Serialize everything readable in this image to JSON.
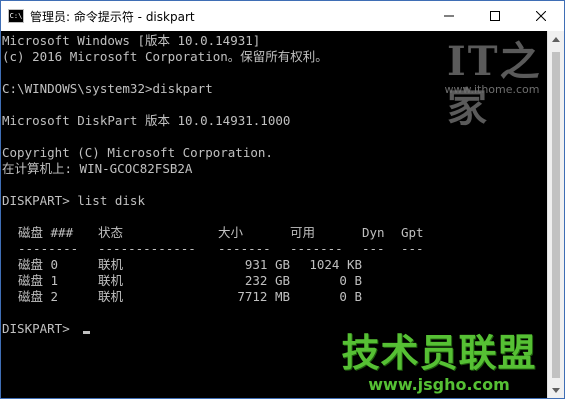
{
  "window": {
    "icon_text": "C:\\",
    "title": "管理员: 命令提示符 - diskpart",
    "controls": {
      "minimize": "minimize",
      "maximize": "maximize",
      "close": "close"
    }
  },
  "console": {
    "lines": [
      "Microsoft Windows [版本 10.0.14931]",
      "(c) 2016 Microsoft Corporation。保留所有权利。",
      "",
      "C:\\WINDOWS\\system32>diskpart",
      "",
      "Microsoft DiskPart 版本 10.0.14931.1000",
      "",
      "Copyright (C) Microsoft Corporation.",
      "在计算机上: WIN-GCOC82FSB2A",
      "",
      "DISKPART> list disk"
    ],
    "table": {
      "headers": [
        "磁盘 ###",
        "状态",
        "大小",
        "可用",
        "Dyn",
        "Gpt"
      ],
      "dividers": [
        "--------",
        "-------------",
        "-------",
        "-------",
        "---",
        "---"
      ],
      "rows": [
        [
          "磁盘 0",
          "联机",
          "931 GB",
          "1024 KB",
          "",
          ""
        ],
        [
          "磁盘 1",
          "联机",
          "232 GB",
          "0 B",
          "",
          ""
        ],
        [
          "磁盘 2",
          "联机",
          "7712 MB",
          "0 B",
          "",
          ""
        ]
      ]
    },
    "prompt": "DISKPART> ",
    "text_color": "#c0c0c0",
    "background": "#000000"
  },
  "watermarks": {
    "ithome": {
      "mark": "IT之家",
      "url": "www.ithome.com"
    },
    "jsgho": {
      "name": "技术员联盟",
      "url": "www.jsgho.com",
      "color": "#56c034"
    }
  }
}
